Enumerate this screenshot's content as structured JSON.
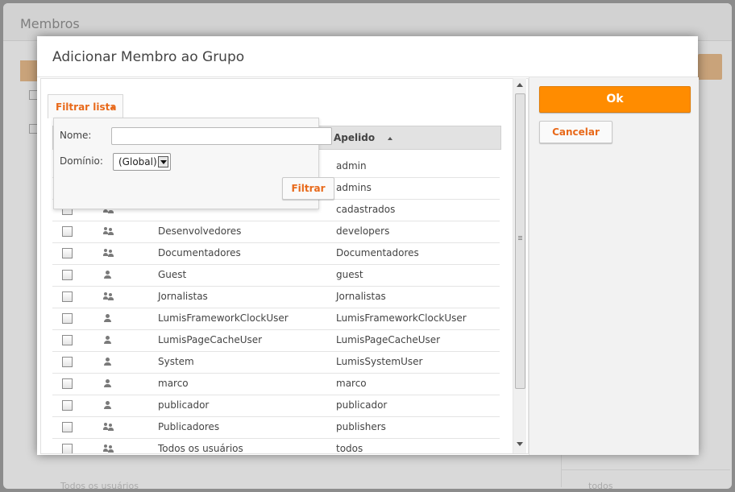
{
  "background": {
    "title": "Membros",
    "footer_left": "Todos os usuários",
    "footer_right": "todos"
  },
  "modal": {
    "title": "Adicionar Membro ao Grupo",
    "ok_label": "Ok",
    "cancel_label": "Cancelar"
  },
  "filter": {
    "tab_label": "Filtrar lista",
    "name_label": "Nome:",
    "name_value": "",
    "domain_label": "Domínio:",
    "domain_selected": "(Global)",
    "filter_button": "Filtrar"
  },
  "table": {
    "alias_header": "Apelido",
    "rows": [
      {
        "name": "",
        "alias": "admin",
        "icon": "user-icon"
      },
      {
        "name": "",
        "alias": "admins",
        "icon": "group-icon"
      },
      {
        "name": "",
        "alias": "cadastrados",
        "icon": "group-icon"
      },
      {
        "name": "Desenvolvedores",
        "alias": "developers",
        "icon": "group-icon"
      },
      {
        "name": "Documentadores",
        "alias": "Documentadores",
        "icon": "group-icon"
      },
      {
        "name": "Guest",
        "alias": "guest",
        "icon": "user-icon"
      },
      {
        "name": "Jornalistas",
        "alias": "Jornalistas",
        "icon": "group-icon"
      },
      {
        "name": "LumisFrameworkClockUser",
        "alias": "LumisFrameworkClockUser",
        "icon": "user-icon"
      },
      {
        "name": "LumisPageCacheUser",
        "alias": "LumisPageCacheUser",
        "icon": "user-icon"
      },
      {
        "name": "System",
        "alias": "LumisSystemUser",
        "icon": "user-icon"
      },
      {
        "name": "marco",
        "alias": "marco",
        "icon": "user-icon"
      },
      {
        "name": "publicador",
        "alias": "publicador",
        "icon": "user-icon"
      },
      {
        "name": "Publicadores",
        "alias": "publishers",
        "icon": "group-icon"
      },
      {
        "name": "Todos os usuários",
        "alias": "todos",
        "icon": "group-icon"
      }
    ]
  },
  "colors": {
    "accent": "#ff8c00",
    "link": "#e8691a"
  }
}
